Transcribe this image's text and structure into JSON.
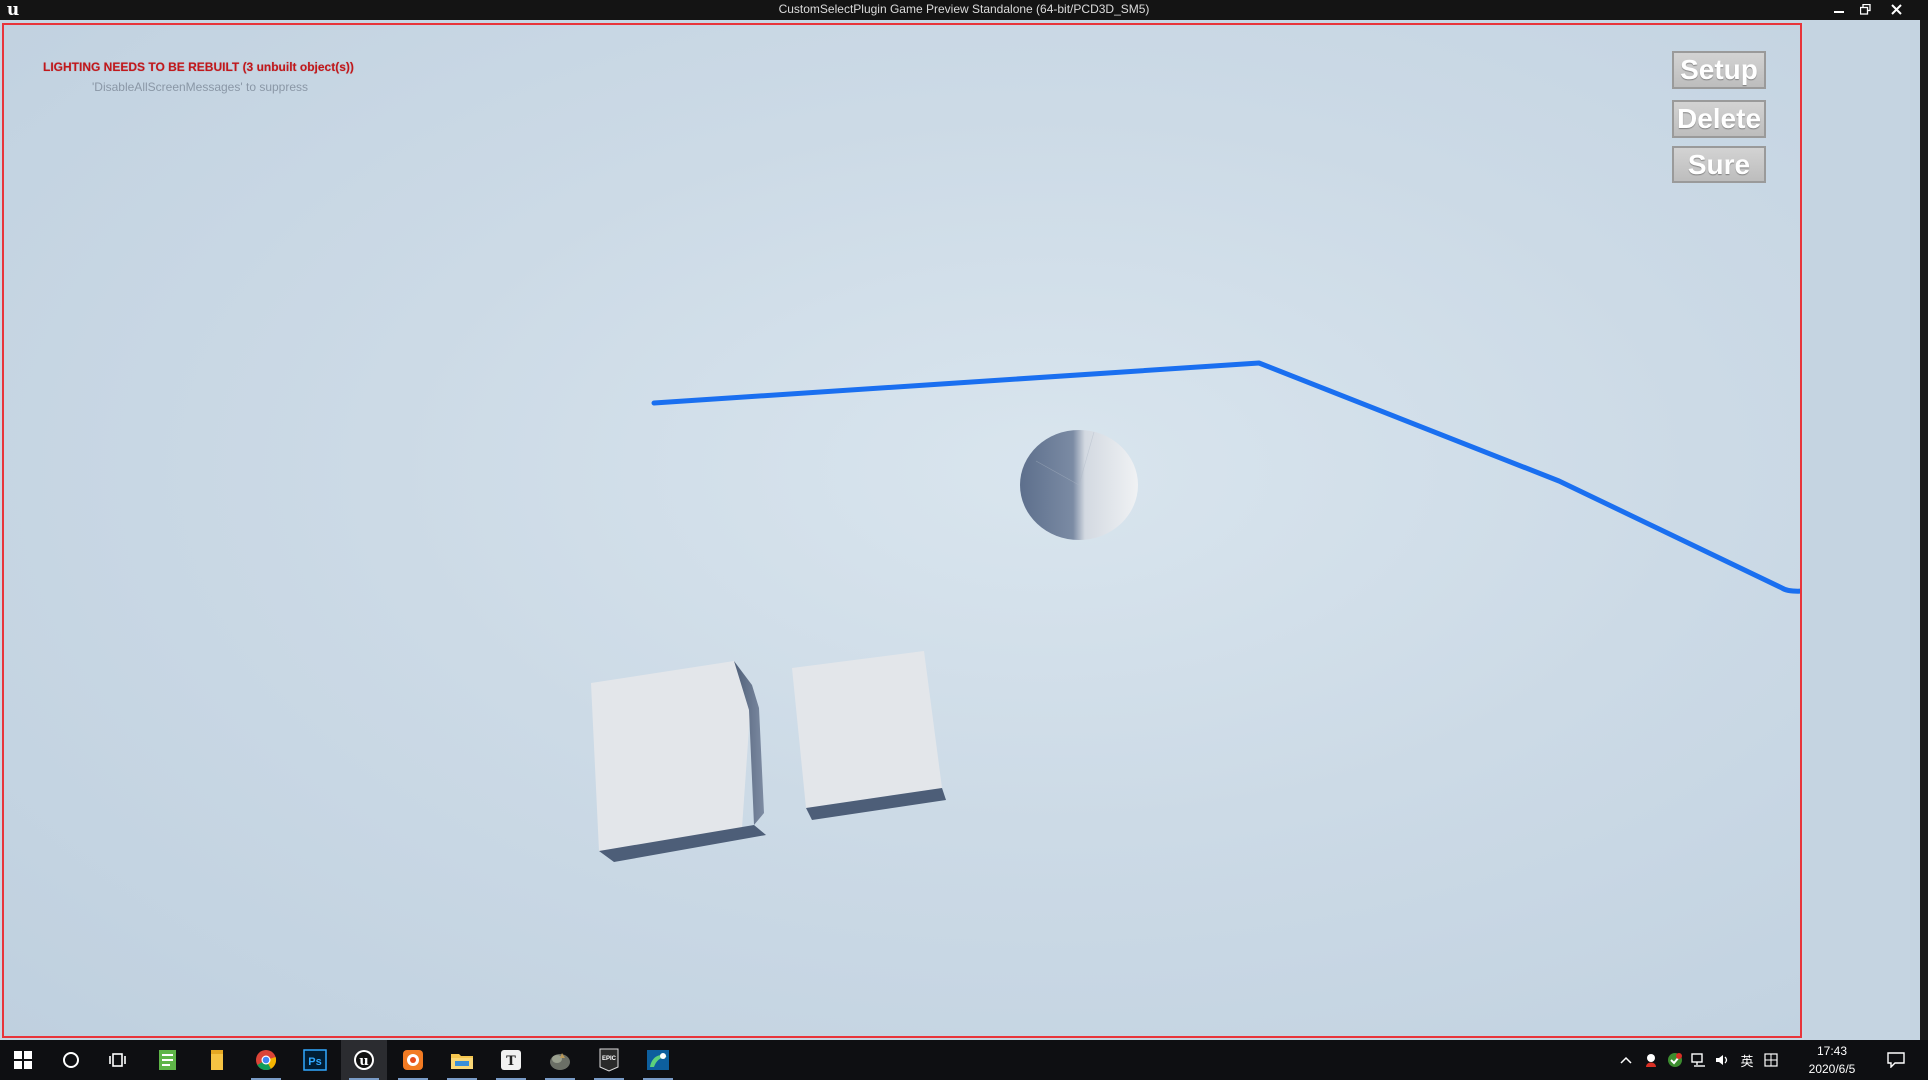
{
  "window": {
    "title": "CustomSelectPlugin Game Preview Standalone (64-bit/PCD3D_SM5)",
    "logo_icon": "unreal-engine-logo",
    "logo_letter": "u",
    "controls": {
      "minimize": "minimize-icon",
      "restore": "restore-icon",
      "close": "close-icon"
    }
  },
  "viewport": {
    "warning": "LIGHTING NEEDS TO BE REBUILT (3 unbuilt object(s))",
    "suppress_hint": "'DisableAllScreenMessages' to suppress",
    "border_color": "#e8343a",
    "spline_color": "#1a6ff0"
  },
  "buttons": {
    "setup": "Setup",
    "delete": "Delete",
    "sure": "Sure"
  },
  "taskbar": {
    "apps": [
      "windows-start-icon",
      "search-circle-icon",
      "task-view-icon",
      "notepad-icon",
      "sticky-notes-icon",
      "chrome-icon",
      "photoshop-icon",
      "unreal-engine-icon",
      "app-orange-icon",
      "file-explorer-icon",
      "typora-icon",
      "app-rock-icon",
      "epic-games-icon",
      "app-swirl-icon"
    ],
    "photoshop_label": "Ps",
    "typora_label": "T",
    "epic_label": "EPIC",
    "tray_language": "英",
    "time": "17:43",
    "date": "2020/6/5"
  }
}
